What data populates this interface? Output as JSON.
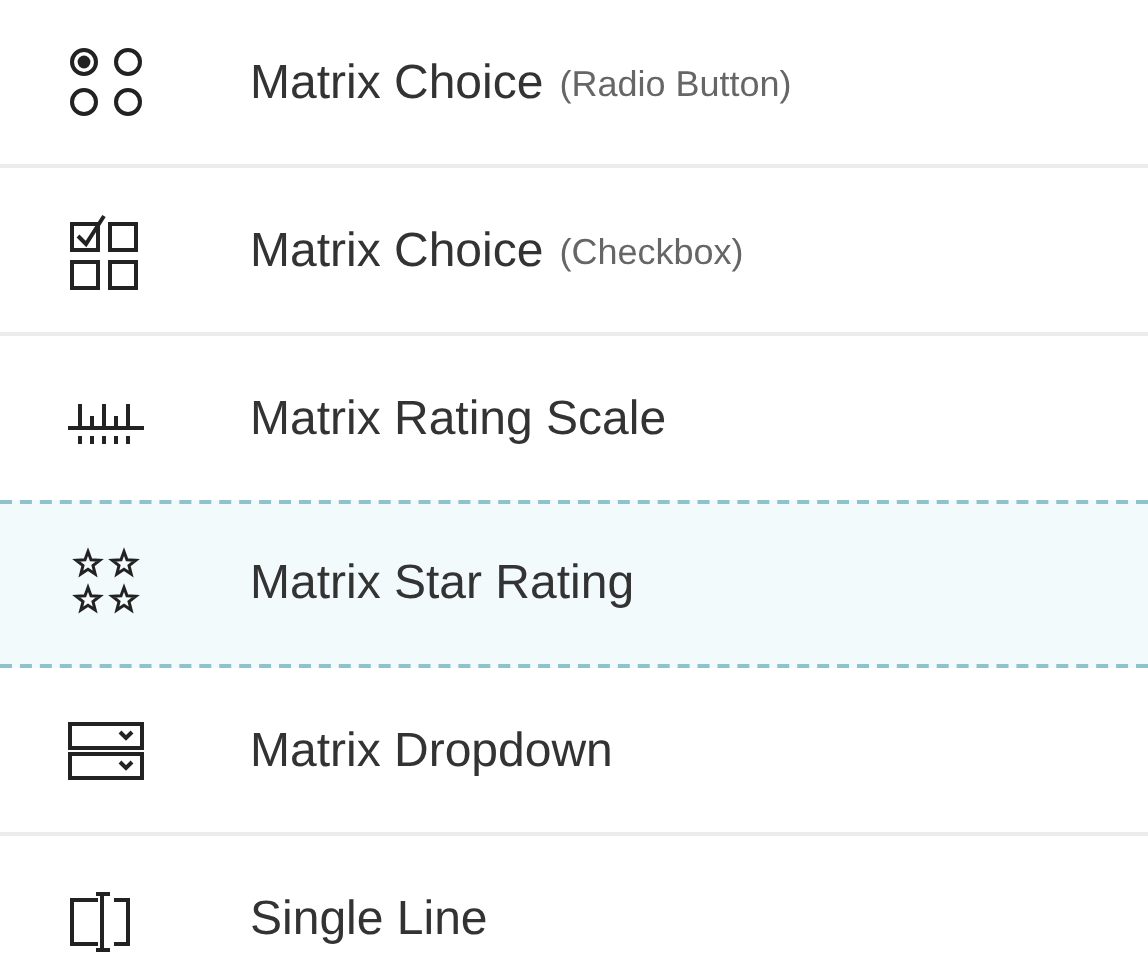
{
  "question_types": [
    {
      "kind": "radio-matrix",
      "label": "Matrix Choice",
      "note": "(Radio Button)",
      "selected": false
    },
    {
      "kind": "checkbox-matrix",
      "label": "Matrix Choice",
      "note": "(Checkbox)",
      "selected": false
    },
    {
      "kind": "rating-scale",
      "label": "Matrix Rating Scale",
      "selected": false
    },
    {
      "kind": "star-rating",
      "label": "Matrix Star Rating",
      "selected": true
    },
    {
      "kind": "dropdown",
      "label": "Matrix Dropdown",
      "selected": false
    },
    {
      "kind": "single-line",
      "label": "Single Line",
      "selected": false
    }
  ]
}
